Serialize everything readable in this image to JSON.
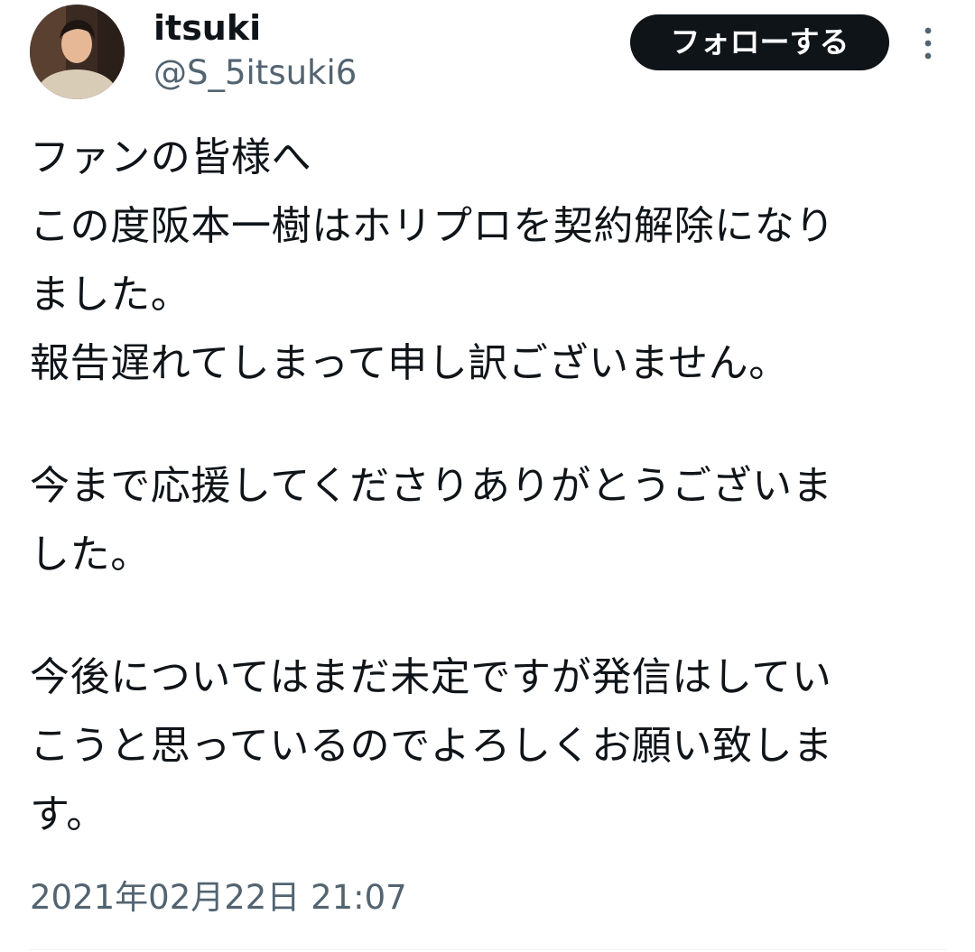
{
  "author": {
    "display_name": "itsuki",
    "handle": "@S_5itsuki6"
  },
  "actions": {
    "follow_label": "フォローする",
    "more_icon": "more-vertical-icon"
  },
  "tweet": {
    "lines": [
      "ファンの皆様へ",
      "この度阪本一樹はホリプロを契約解除になり",
      "ました。",
      "報告遅れてしまって申し訳ございません。",
      "今まで応援してくださりありがとうございま",
      "した。",
      "今後についてはまだ未定ですが発信はしてい",
      "こうと思っているのでよろしくお願い致しま",
      "す。"
    ],
    "timestamp": "2021年02月22日 21:07"
  },
  "colors": {
    "text": "#0f1419",
    "secondary_text": "#536471",
    "follow_button_bg": "#0f1419",
    "follow_button_text": "#ffffff",
    "divider": "#eff3f4"
  }
}
